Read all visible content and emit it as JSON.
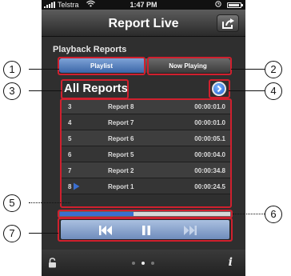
{
  "status_bar": {
    "carrier": "Telstra",
    "time": "1:47 PM"
  },
  "nav": {
    "title": "Report Live",
    "share_icon": "share-export-icon"
  },
  "section": {
    "title": "Playback Reports"
  },
  "segmented": {
    "left_label": "Playlist",
    "right_label": "Now Playing",
    "selected": "Playlist"
  },
  "list": {
    "header": "All Reports",
    "rows": [
      {
        "num": "3",
        "name": "Report 8",
        "duration": "00:00:01.0"
      },
      {
        "num": "4",
        "name": "Report 7",
        "duration": "00:00:01.0"
      },
      {
        "num": "5",
        "name": "Report 6",
        "duration": "00:00:05.1"
      },
      {
        "num": "6",
        "name": "Report 5",
        "duration": "00:00:04.0"
      },
      {
        "num": "7",
        "name": "Report 2",
        "duration": "00:00:34.8"
      },
      {
        "num": "8",
        "name": "Report 1",
        "duration": "00:00:24.5",
        "playing": true
      }
    ]
  },
  "player": {
    "progress_fraction": 0.43,
    "controls": [
      "previous-icon",
      "pause-icon",
      "next-icon"
    ]
  },
  "bottom_bar": {
    "info_label": "i",
    "page_count": 3,
    "active_page": 2
  },
  "callouts": [
    "1",
    "2",
    "3",
    "4",
    "5",
    "6",
    "7"
  ],
  "colors": {
    "highlight": "#d0202e",
    "accent_blue": "#3b66a8",
    "progress": "#3b6fd0"
  }
}
